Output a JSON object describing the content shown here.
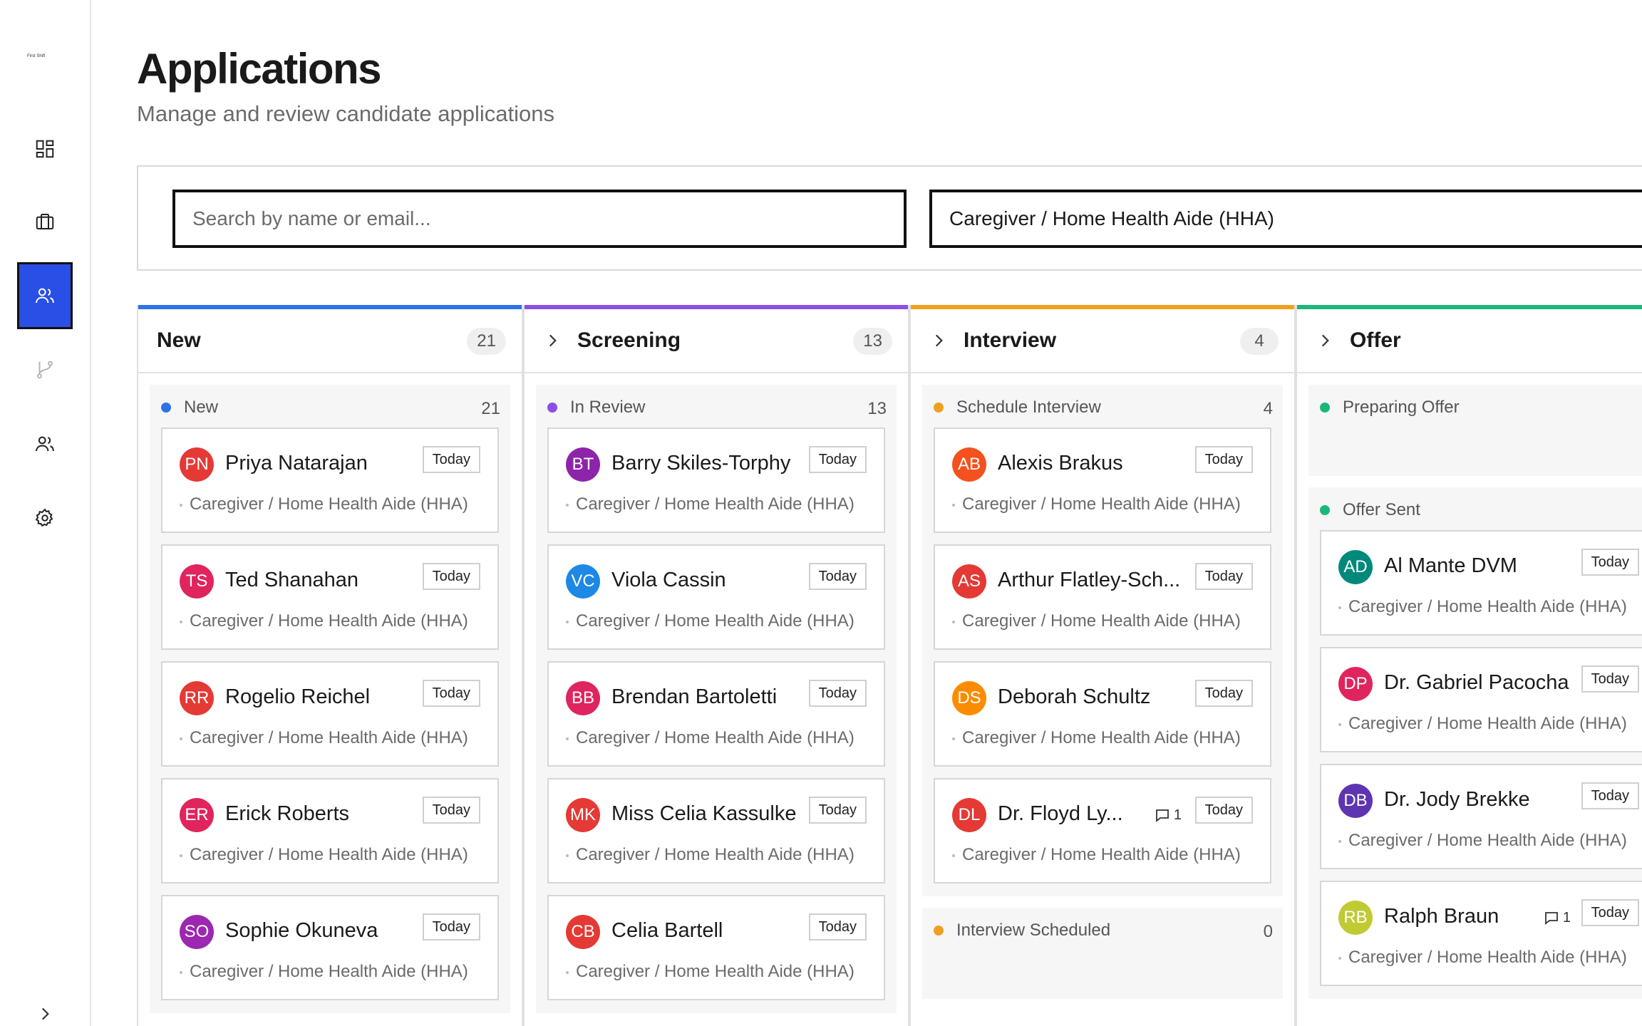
{
  "sidebar": {
    "logo_text": "First Shift",
    "items": [
      {
        "id": "dashboard",
        "icon": "dashboard-icon"
      },
      {
        "id": "jobs",
        "icon": "briefcase-icon"
      },
      {
        "id": "applications",
        "icon": "users-icon",
        "active": true
      },
      {
        "id": "pipeline",
        "icon": "git-branch-icon",
        "disabled": true
      },
      {
        "id": "contacts",
        "icon": "people-icon"
      },
      {
        "id": "settings",
        "icon": "gear-icon"
      }
    ]
  },
  "header": {
    "title": "Applications",
    "subtitle": "Manage and review candidate applications"
  },
  "filters": {
    "search_placeholder": "Search by name or email...",
    "job_select_value": "Caregiver / Home Health Aide (HHA)"
  },
  "colors": {
    "new": "#2d72e8",
    "screening": "#8b4fe6",
    "interview": "#f0a020",
    "offer": "#1bb77a",
    "active_nav": "#2a4fe6"
  },
  "board": {
    "columns": [
      {
        "title": "New",
        "count": "21",
        "groups": [
          {
            "name": "New",
            "count": "21",
            "dot": "#2d72e8",
            "cards": [
              {
                "initials": "PN",
                "name": "Priya Natarajan",
                "date": "Today",
                "role": "Caregiver / Home Health Aide (HHA)",
                "color": "#e53935"
              },
              {
                "initials": "TS",
                "name": "Ted Shanahan",
                "date": "Today",
                "role": "Caregiver / Home Health Aide (HHA)",
                "color": "#e0245e"
              },
              {
                "initials": "RR",
                "name": "Rogelio Reichel",
                "date": "Today",
                "role": "Caregiver / Home Health Aide (HHA)",
                "color": "#e53935"
              },
              {
                "initials": "ER",
                "name": "Erick Roberts",
                "date": "Today",
                "role": "Caregiver / Home Health Aide (HHA)",
                "color": "#e0245e"
              },
              {
                "initials": "SO",
                "name": "Sophie Okuneva",
                "date": "Today",
                "role": "Caregiver / Home Health Aide (HHA)",
                "color": "#9c27b0"
              }
            ]
          }
        ]
      },
      {
        "title": "Screening",
        "count": "13",
        "groups": [
          {
            "name": "In Review",
            "count": "13",
            "dot": "#8b4fe6",
            "cards": [
              {
                "initials": "BT",
                "name": "Barry Skiles-Torphy",
                "date": "Today",
                "role": "Caregiver / Home Health Aide (HHA)",
                "color": "#8e24aa"
              },
              {
                "initials": "VC",
                "name": "Viola Cassin",
                "date": "Today",
                "role": "Caregiver / Home Health Aide (HHA)",
                "color": "#1e88e5"
              },
              {
                "initials": "BB",
                "name": "Brendan Bartoletti",
                "date": "Today",
                "role": "Caregiver / Home Health Aide (HHA)",
                "color": "#e0245e"
              },
              {
                "initials": "MK",
                "name": "Miss Celia Kassulke",
                "date": "Today",
                "role": "Caregiver / Home Health Aide (HHA)",
                "color": "#e53935"
              },
              {
                "initials": "CB",
                "name": "Celia Bartell",
                "date": "Today",
                "role": "Caregiver / Home Health Aide (HHA)",
                "color": "#e53935"
              }
            ]
          }
        ]
      },
      {
        "title": "Interview",
        "count": "4",
        "groups": [
          {
            "name": "Schedule Interview",
            "count": "4",
            "dot": "#f0a020",
            "cards": [
              {
                "initials": "AB",
                "name": "Alexis Brakus",
                "date": "Today",
                "role": "Caregiver / Home Health Aide (HHA)",
                "color": "#f4511e"
              },
              {
                "initials": "AS",
                "name": "Arthur Flatley-Sch...",
                "date": "Today",
                "role": "Caregiver / Home Health Aide (HHA)",
                "color": "#e53935"
              },
              {
                "initials": "DS",
                "name": "Deborah Schultz",
                "date": "Today",
                "role": "Caregiver / Home Health Aide (HHA)",
                "color": "#fb8c00"
              },
              {
                "initials": "DL",
                "name": "Dr. Floyd Ly...",
                "date": "Today",
                "role": "Caregiver / Home Health Aide (HHA)",
                "color": "#e53935",
                "comments": "1"
              }
            ]
          },
          {
            "name": "Interview Scheduled",
            "count": "0",
            "dot": "#f0a020",
            "cards": []
          }
        ]
      },
      {
        "title": "Offer",
        "count": "",
        "groups": [
          {
            "name": "Preparing Offer",
            "count": "",
            "dot": "#1bb77a",
            "cards": []
          },
          {
            "name": "Offer Sent",
            "count": "",
            "dot": "#1bb77a",
            "cards": [
              {
                "initials": "AD",
                "name": "Al Mante DVM",
                "date": "Today",
                "role": "Caregiver / Home Health Aide (HHA)",
                "color": "#00897b"
              },
              {
                "initials": "DP",
                "name": "Dr. Gabriel Pacocha",
                "date": "Today",
                "role": "Caregiver / Home Health Aide (HHA)",
                "color": "#e0245e"
              },
              {
                "initials": "DB",
                "name": "Dr. Jody Brekke",
                "date": "Today",
                "role": "Caregiver / Home Health Aide (HHA)",
                "color": "#5e35b1"
              },
              {
                "initials": "RB",
                "name": "Ralph Braun",
                "date": "Today",
                "role": "Caregiver / Home Health Aide (HHA)",
                "color": "#c0ca33",
                "comments": "1"
              }
            ]
          }
        ]
      }
    ]
  }
}
